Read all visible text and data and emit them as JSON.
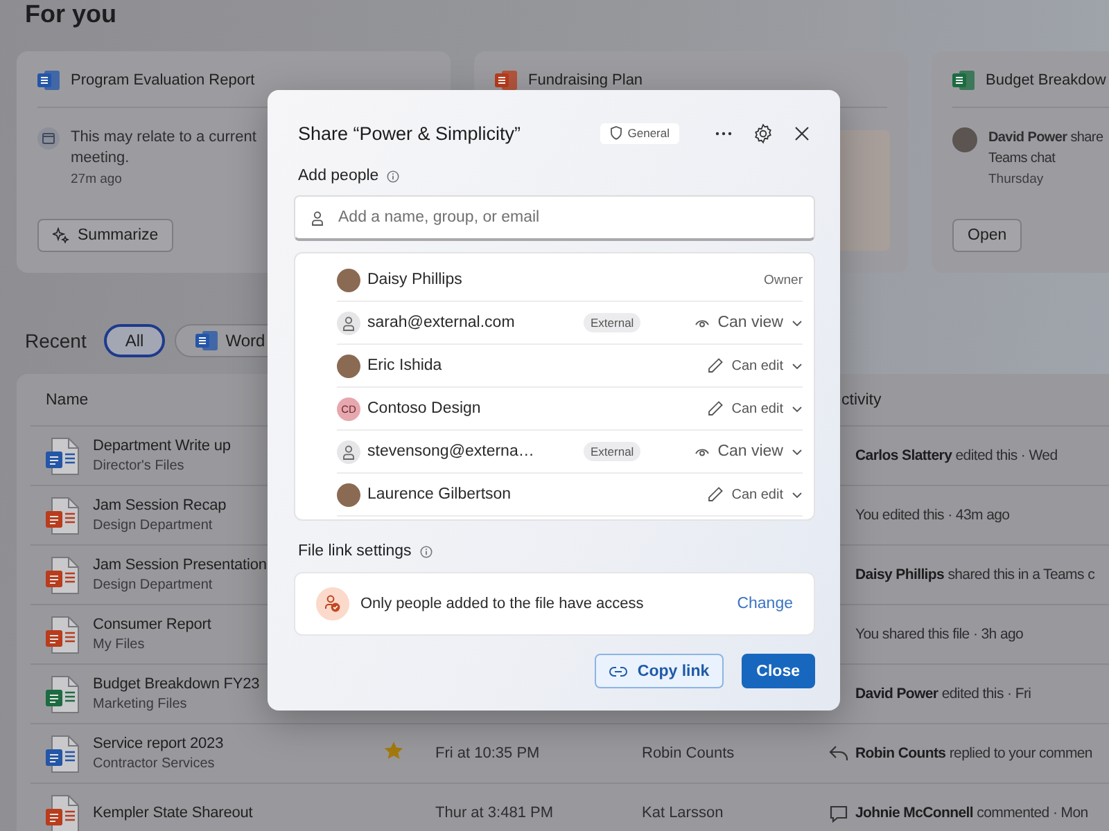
{
  "page": {
    "title": "For you"
  },
  "cards": [
    {
      "kind": "word",
      "title": "Program Evaluation Report",
      "message": "This may relate to a current meeting.",
      "time": "27m ago",
      "action": "Summarize"
    },
    {
      "kind": "powerpoint",
      "title": "Fundraising Plan"
    },
    {
      "kind": "excel",
      "title": "Budget Breakdow",
      "message_line_1": "**David Power** share",
      "message_line_2": "Teams chat",
      "time": "Thursday",
      "action": "Open"
    }
  ],
  "recent": {
    "title": "Recent",
    "filters": [
      {
        "label": "All",
        "selected": true,
        "kind": "plain"
      },
      {
        "label": "Word",
        "selected": false,
        "kind": "word"
      }
    ],
    "columns": {
      "name": "Name",
      "activity": "ctivity"
    },
    "rows": [
      {
        "kind": "word",
        "name": "Department Write up",
        "location": "Director's Files",
        "starred": false,
        "activity": {
          "text": "**Carlos Slattery** edited this · Wed"
        }
      },
      {
        "kind": "powerpoint",
        "name": "Jam Session Recap",
        "location": "Design Department",
        "starred": false,
        "activity": {
          "text": "You edited this · 43m ago"
        }
      },
      {
        "kind": "powerpoint",
        "name": "Jam Session Presentation",
        "location": "Design Department",
        "starred": false,
        "activity": {
          "text": "**Daisy Phillips** shared this in a Teams c"
        }
      },
      {
        "kind": "powerpoint",
        "name": "Consumer Report",
        "location": "My Files",
        "starred": false,
        "activity": {
          "text": "You shared this file · 3h ago"
        }
      },
      {
        "kind": "excel",
        "name": "Budget Breakdown FY23",
        "location": "Marketing Files",
        "starred": false,
        "activity": {
          "text": "**David Power** edited this · Fri"
        }
      },
      {
        "kind": "word",
        "name": "Service report 2023",
        "location": "Contractor Services",
        "starred": true,
        "date": "Fri at 10:35 PM",
        "person": "Robin Counts",
        "activity": {
          "kind": "reply",
          "text": "**Robin Counts** replied to your commen"
        }
      },
      {
        "kind": "powerpoint",
        "name": "Kempler State Shareout",
        "starred": false,
        "date": "Thur at 3:481 PM",
        "person": "Kat Larsson",
        "activity": {
          "kind": "comment",
          "text": "**Johnie McConnell** commented · Mon"
        }
      }
    ]
  },
  "dialog": {
    "title": "Share “Power & Simplicity”",
    "label": "General",
    "add_people": {
      "heading": "Add people",
      "placeholder": "Add a name, group, or email"
    },
    "people": [
      {
        "kind": "photo",
        "name": "Daisy Phillips",
        "access": {
          "kind": "owner",
          "label": "Owner"
        }
      },
      {
        "kind": "generic",
        "name": "sarah@external.com",
        "badge": "External",
        "access": {
          "kind": "view",
          "label": "Can view"
        }
      },
      {
        "kind": "photo",
        "name": "Eric Ishida",
        "access": {
          "kind": "edit",
          "label": "Can edit"
        }
      },
      {
        "kind": "initials",
        "initials": "CD",
        "name": "Contoso Design",
        "access": {
          "kind": "edit",
          "label": "Can edit"
        }
      },
      {
        "kind": "generic",
        "name": "stevensong@externa…",
        "badge": "External",
        "access": {
          "kind": "view",
          "label": "Can view"
        }
      },
      {
        "kind": "photo",
        "name": "Laurence Gilbertson",
        "access": {
          "kind": "edit",
          "label": "Can edit"
        }
      }
    ],
    "link_settings": {
      "heading": "File link settings",
      "message": "Only people added to the file have access",
      "action": "Change"
    },
    "buttons": [
      {
        "label": "Copy link",
        "kind": "secondary"
      },
      {
        "label": "Close",
        "kind": "primary"
      }
    ]
  }
}
